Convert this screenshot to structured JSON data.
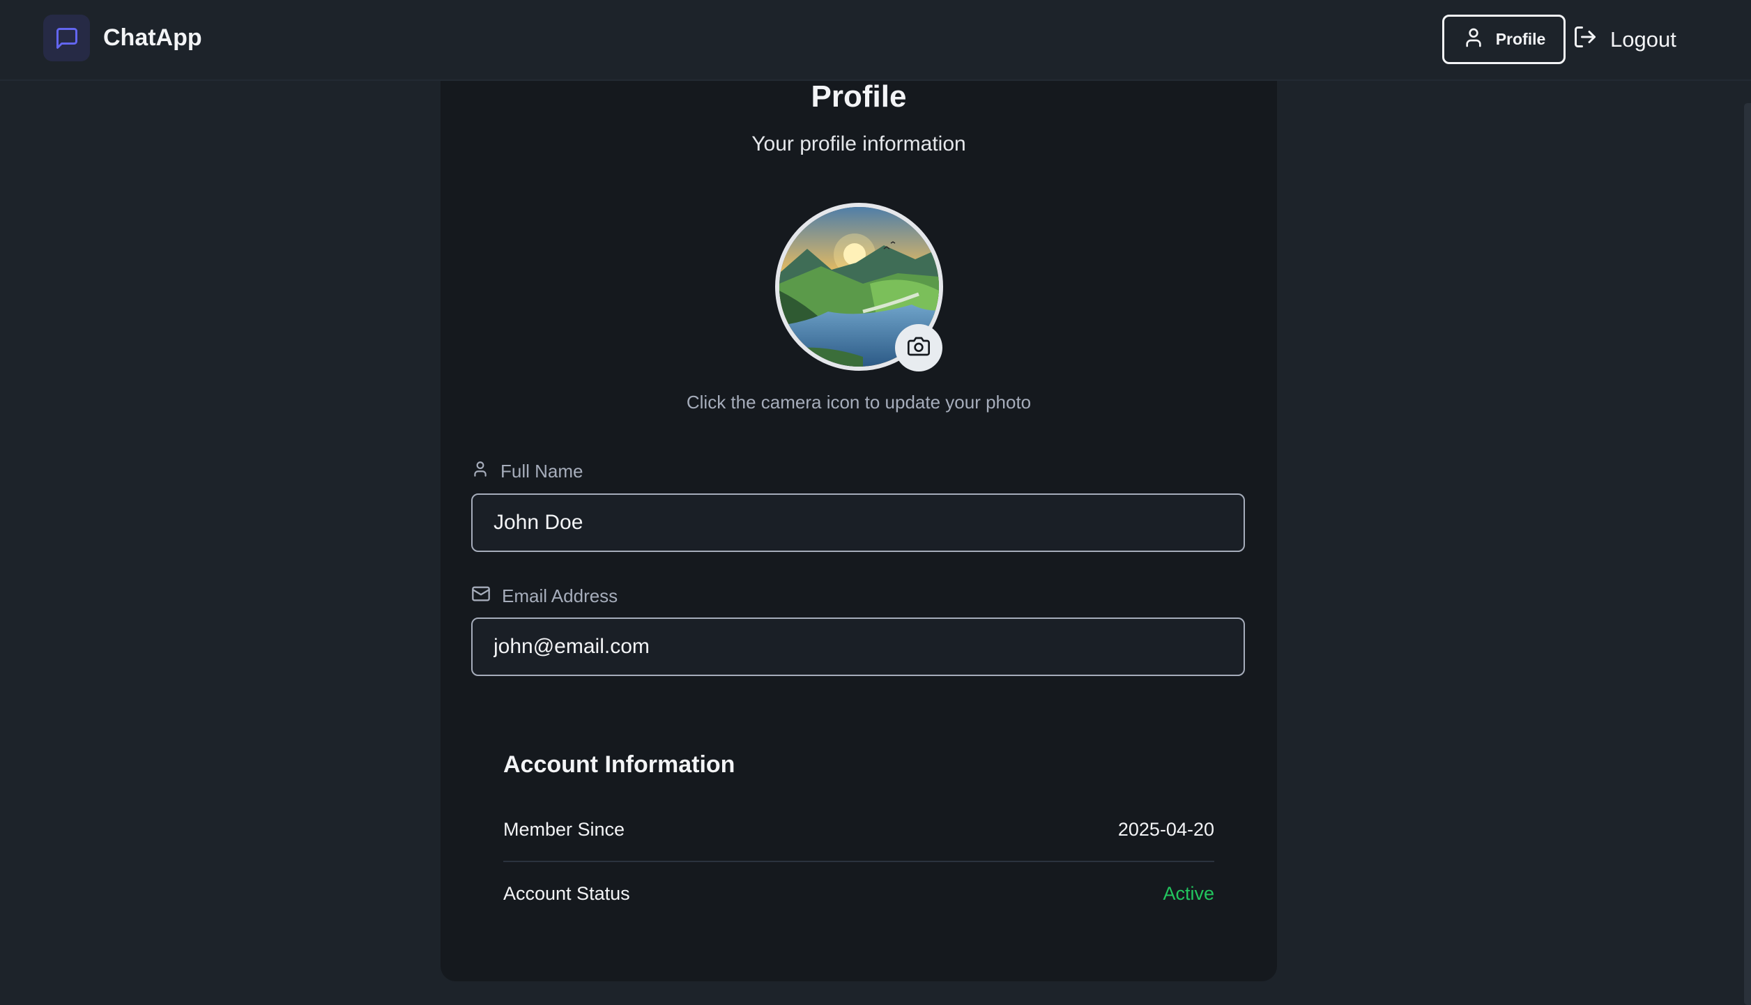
{
  "navbar": {
    "brand": "ChatApp",
    "profile_label": "Profile",
    "logout_label": "Logout"
  },
  "profile": {
    "title": "Profile",
    "subtitle": "Your profile information",
    "avatar_hint": "Click the camera icon to update your photo"
  },
  "fields": {
    "name_label": "Full Name",
    "name_value": "John Doe",
    "email_label": "Email Address",
    "email_value": "john@email.com"
  },
  "account": {
    "title": "Account Information",
    "rows": [
      {
        "label": "Member Since",
        "value": "2025-04-20"
      },
      {
        "label": "Account Status",
        "value": "Active"
      }
    ]
  },
  "colors": {
    "accent": "#6366f1",
    "status_active": "#22c55e",
    "card_bg": "#15191e",
    "page_bg": "#1d232a"
  },
  "icons": {
    "brand": "message-square-icon",
    "profile": "user-icon",
    "logout": "log-out-icon",
    "camera": "camera-icon",
    "name": "user-icon",
    "email": "mail-icon"
  }
}
